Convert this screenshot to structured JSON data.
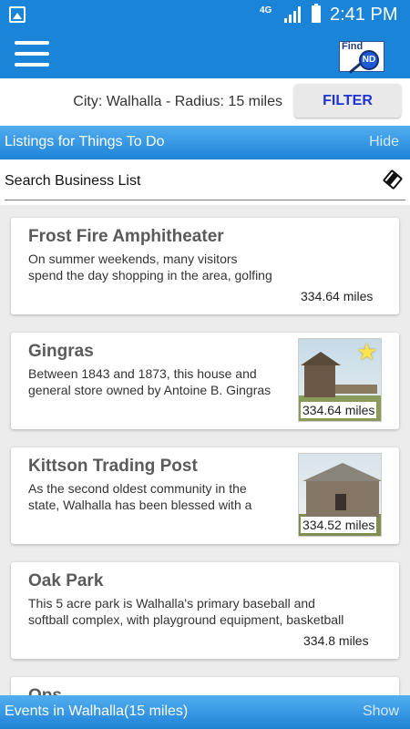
{
  "status_bar": {
    "network": "4G",
    "time": "2:41 PM"
  },
  "app_bar": {
    "logo_text": "Find",
    "logo_badge": "ND"
  },
  "filter_bar": {
    "city_label": "City: Walhalla - Radius: 15 miles",
    "filter_label": "FILTER"
  },
  "listings_header": {
    "title": "Listings for Things To Do",
    "action": "Hide"
  },
  "search": {
    "placeholder": "Search Business List"
  },
  "listings": [
    {
      "name": "Frost Fire Amphitheater",
      "line1": "On summer weekends, many visitors",
      "line2": "spend the day shopping in the area, golfing",
      "distance": "334.64 miles"
    },
    {
      "name": "Gingras",
      "line1": "Between 1843 and 1873, this house and",
      "line2": "general store owned by Antoine B. Gingras",
      "distance": "334.64 miles"
    },
    {
      "name": "Kittson Trading Post",
      "line1": "As the second oldest community in the",
      "line2": "state, Walhalla has been blessed with a",
      "distance": "334.52 miles"
    },
    {
      "name": "Oak Park",
      "line1": "This 5 acre park is Walhalla's primary baseball and",
      "line2": "softball complex, with playground equipment, basketball",
      "distance": "334.8 miles"
    },
    {
      "name": "Ops"
    }
  ],
  "events_footer": {
    "title": "Events in Walhalla(15 miles)",
    "action": "Show"
  }
}
